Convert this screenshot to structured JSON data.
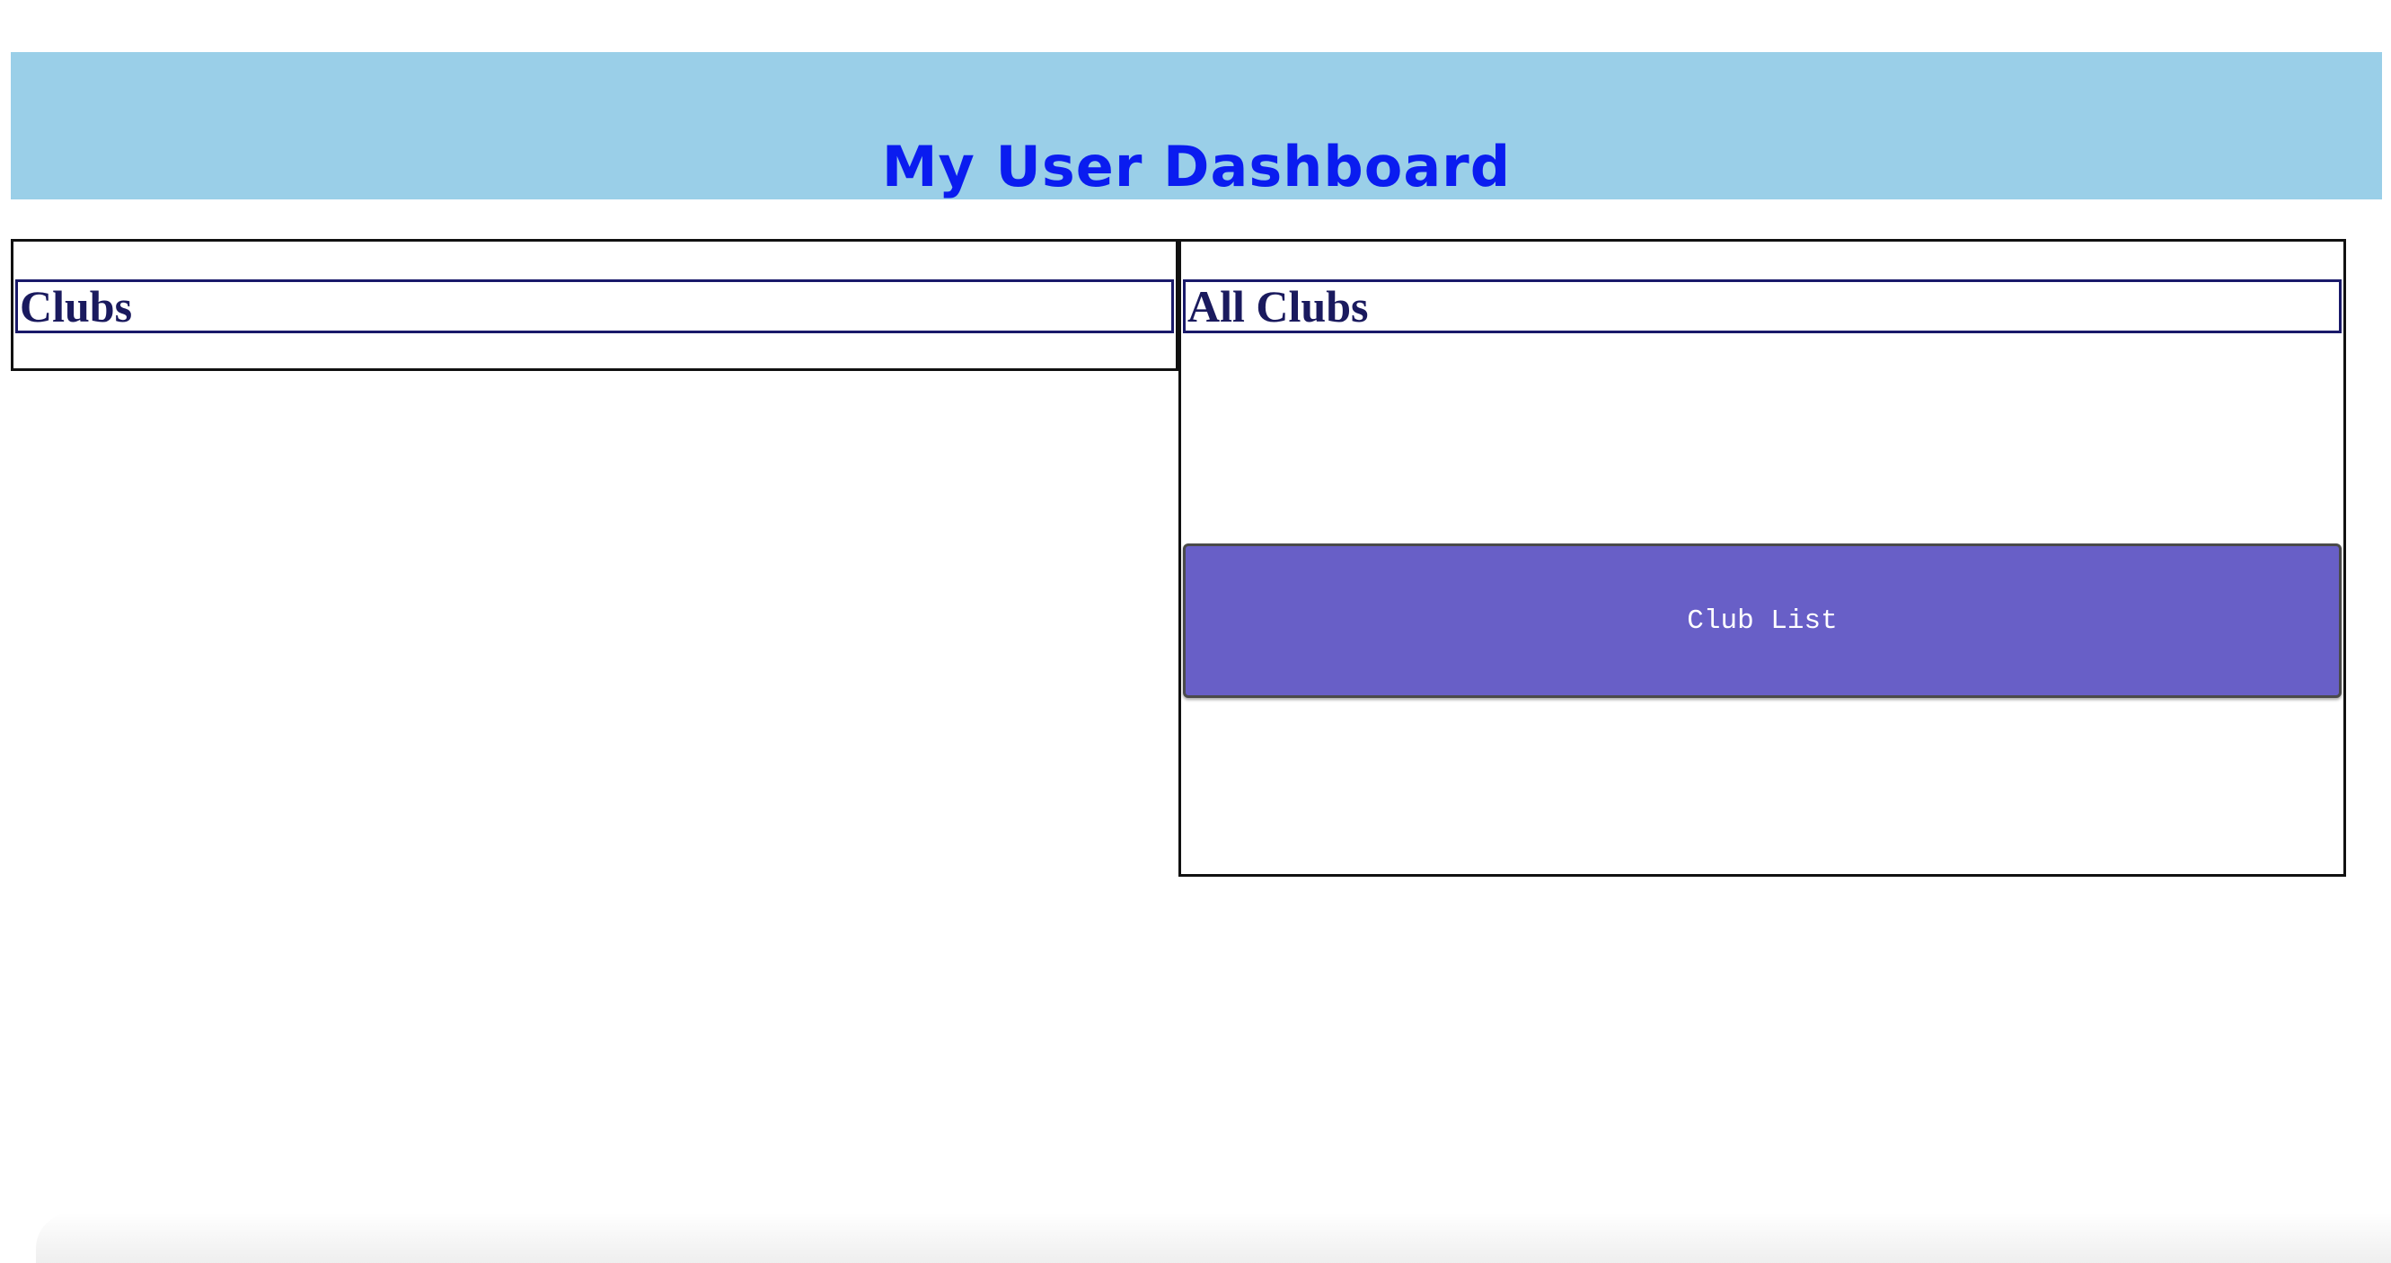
{
  "header": {
    "title": "My User Dashboard",
    "background_color": "#9acfe8",
    "title_color": "#0a1cf0"
  },
  "clubs_panel": {
    "heading": "Clubs"
  },
  "all_clubs_panel": {
    "heading": "All Clubs",
    "club_list_button_label": "Club List",
    "button_color": "#685fc7"
  }
}
